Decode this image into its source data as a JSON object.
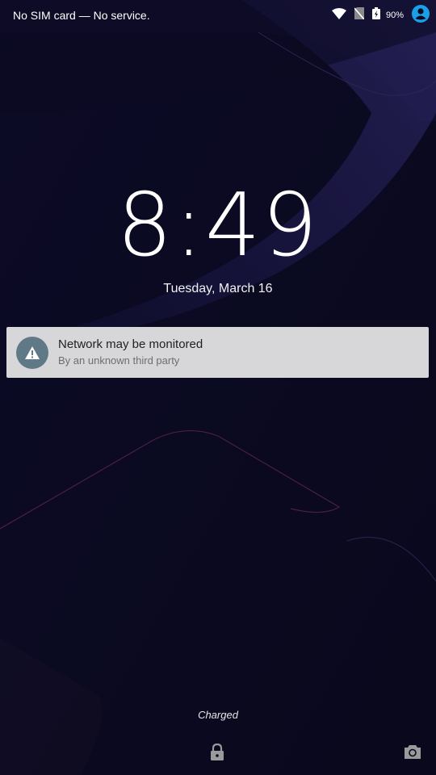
{
  "status_bar": {
    "carrier_text": "No SIM card — No service.",
    "battery_percent": "90%",
    "icons": [
      "wifi-icon",
      "no-sim-icon",
      "battery-charging-icon",
      "user-avatar-icon"
    ]
  },
  "lockscreen": {
    "time": "8:49",
    "date": "Tuesday, March 16",
    "charging_status": "Charged"
  },
  "notification": {
    "title": "Network may be monitored",
    "subtitle": "By an unknown third party",
    "icon": "warning-icon",
    "icon_bg_color": "#5f7a86"
  },
  "bottom_bar": {
    "icons": [
      "lock-icon",
      "camera-icon"
    ]
  },
  "colors": {
    "background": "#0a0920",
    "notification_bg": "#d7d7da",
    "accent": "#1aa0e8"
  }
}
